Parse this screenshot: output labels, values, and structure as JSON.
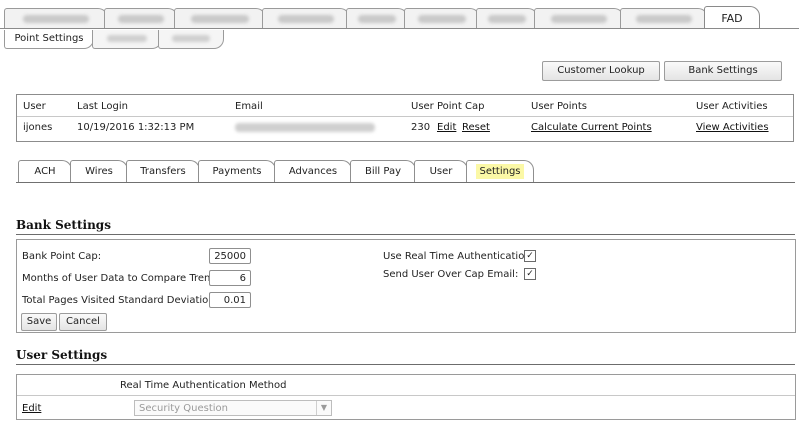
{
  "top_tabs": {
    "active_label": "FAD",
    "blurred_tabs": [
      "tab-1",
      "tab-2",
      "tab-3",
      "tab-4",
      "tab-5",
      "tab-6",
      "tab-7",
      "tab-8",
      "tab-9"
    ]
  },
  "sub_tabs": {
    "active_label": "Point Settings"
  },
  "actions": {
    "customer_lookup": "Customer Lookup",
    "bank_settings": "Bank Settings"
  },
  "user_table": {
    "headers": {
      "user": "User",
      "last_login": "Last Login",
      "email": "Email",
      "user_point_cap": "User Point Cap",
      "user_points": "User Points",
      "user_activities": "User Activities"
    },
    "row": {
      "user": "ijones",
      "last_login": "10/19/2016 1:32:13 PM",
      "point_cap": "230",
      "edit": "Edit",
      "reset": "Reset",
      "calculate": "Calculate Current Points",
      "view_activities": "View Activities"
    }
  },
  "feature_tabs": [
    "ACH",
    "Wires",
    "Transfers",
    "Payments",
    "Advances",
    "Bill Pay",
    "User",
    "Settings"
  ],
  "bank_settings": {
    "title": "Bank Settings",
    "bank_point_cap_label": "Bank Point Cap:",
    "bank_point_cap_value": "25000",
    "months_label": "Months of User Data to Compare Trends:",
    "months_value": "6",
    "std_dev_label": "Total Pages Visited Standard Deviation:",
    "std_dev_value": "0.01",
    "rta_label": "Use Real Time Authentication:",
    "rta_checked": "✓",
    "over_cap_label": "Send User Over Cap Email:",
    "over_cap_checked": "✓",
    "save": "Save",
    "cancel": "Cancel"
  },
  "user_settings": {
    "title": "User Settings",
    "column_header": "Real Time Authentication Method",
    "edit": "Edit",
    "method_value": "Security Question",
    "dropdown_arrow": "▼"
  }
}
